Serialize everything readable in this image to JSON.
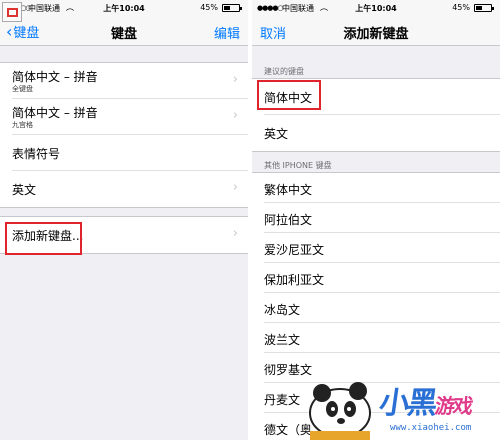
{
  "left": {
    "status": {
      "carrier": "中国联通",
      "time": "上午10:04",
      "battery": "45%",
      "battery_level": 0.45
    },
    "nav": {
      "back_label": "键盘",
      "title": "键盘",
      "edit_label": "编辑"
    },
    "keyboards": [
      {
        "label": "简体中文 – 拼音",
        "sub": "全键盘"
      },
      {
        "label": "简体中文 – 拼音",
        "sub": "九宫格"
      },
      {
        "label": "表情符号",
        "sub": ""
      },
      {
        "label": "英文",
        "sub": ""
      }
    ],
    "add_keyboard_label": "添加新键盘..."
  },
  "right": {
    "status": {
      "carrier": "中国联通",
      "time": "上午10:04",
      "battery": "45%",
      "battery_level": 0.45
    },
    "nav": {
      "cancel_label": "取消",
      "title": "添加新键盘"
    },
    "suggested_header": "建议的键盘",
    "suggested": [
      "简体中文",
      "英文"
    ],
    "other_header": "其他 IPHONE 键盘",
    "others": [
      "繁体中文",
      "阿拉伯文",
      "爱沙尼亚文",
      "保加利亚文",
      "冰岛文",
      "波兰文",
      "彻罗基文",
      "丹麦文",
      "德文（奥"
    ]
  },
  "watermark": {
    "brand": "小黑",
    "brand_sub": "游戏",
    "url": "www.xiaohei.com"
  },
  "colors": {
    "accent": "#007aff",
    "highlight": "#e0242b"
  },
  "icons": {
    "chevron": "chevron-right-icon",
    "back": "chevron-left-icon",
    "wifi": "wifi-icon",
    "battery": "battery-icon"
  }
}
